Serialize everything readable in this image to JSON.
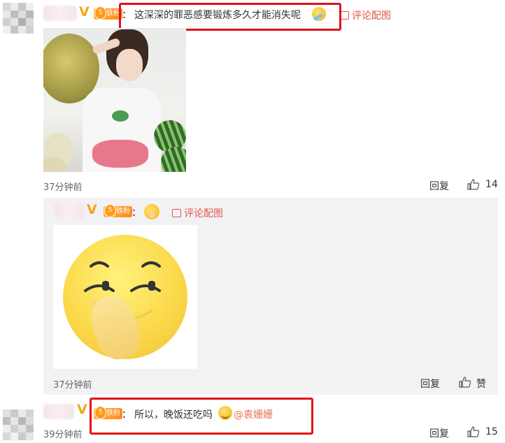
{
  "comments": [
    {
      "separator": "：",
      "text": "这深深的罪恶感要锻炼多久才能消失呢",
      "emoji_icon": "rolling-laugh-emoji-icon",
      "view_image_label": "评论配图",
      "time": "37分钟前",
      "reply_label": "回复",
      "like_count": "14",
      "fan_badge_level": "5",
      "fan_badge_label": "铁粉",
      "verified_label": "V"
    },
    {
      "separator": "：",
      "emoji_icon": "shy-covering-mouth-emoji-icon",
      "view_image_label": "评论配图",
      "time": "37分钟前",
      "reply_label": "回复",
      "like_label": "赞",
      "fan_badge_level": "5",
      "fan_badge_label": "铁粉",
      "verified_label": "V"
    },
    {
      "separator": "：",
      "text": "所以，晚饭还吃吗",
      "emoji_icon": "smile-emoji-icon",
      "mention": "@袁姗姗",
      "time": "39分钟前",
      "reply_label": "回复",
      "like_count": "15",
      "fan_badge_level": "5",
      "fan_badge_label": "铁粉",
      "verified_label": "V"
    }
  ],
  "colors": {
    "highlight_box": "#e0121d",
    "link": "#e2564a",
    "mention": "#eb7350",
    "reply_bg": "#f2f2f5",
    "badge": "#ff9c1a"
  }
}
